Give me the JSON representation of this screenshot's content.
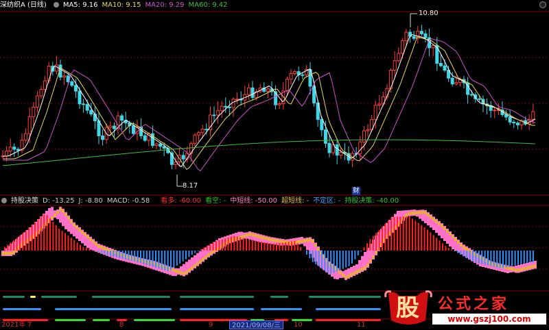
{
  "main_panel": {
    "title": "深纺织A (日线)",
    "ma": [
      {
        "label": "MA5: 9.16",
        "color": "#ffffff"
      },
      {
        "label": "MA10: 9.15",
        "color": "#e8d860"
      },
      {
        "label": "MA20: 9.29",
        "color": "#d050d0"
      },
      {
        "label": "MA60: 9.42",
        "color": "#40c040"
      }
    ],
    "high_marker": "10.80",
    "low_marker": "8.17",
    "event_marker": "财"
  },
  "indicator_panel": {
    "name": "持股决策",
    "values": [
      {
        "label": "D: -13.25",
        "color": "#cccccc"
      },
      {
        "label": "J: -8.80",
        "color": "#cccccc"
      },
      {
        "label": "MACD: -0.58",
        "color": "#cccccc"
      },
      {
        "label": "看多: -60.00",
        "color": "#ff3030"
      },
      {
        "label": "看空: -",
        "color": "#30c030"
      },
      {
        "label": "中短线: -50.00",
        "color": "#ff80c0"
      },
      {
        "label": "超短线: -",
        "color": "#e8c040"
      },
      {
        "label": "不定区: -",
        "color": "#40a0ff"
      },
      {
        "label": "持股决策: -40.00",
        "color": "#30c030"
      }
    ]
  },
  "time_axis": {
    "labels": [
      "2021年",
      "7",
      "8",
      "9",
      "10",
      "11"
    ],
    "crosshair_date": "2021/09/08/三"
  },
  "logo": {
    "char": "股",
    "text": "公式之家",
    "url": "www.gszj100.com"
  }
}
